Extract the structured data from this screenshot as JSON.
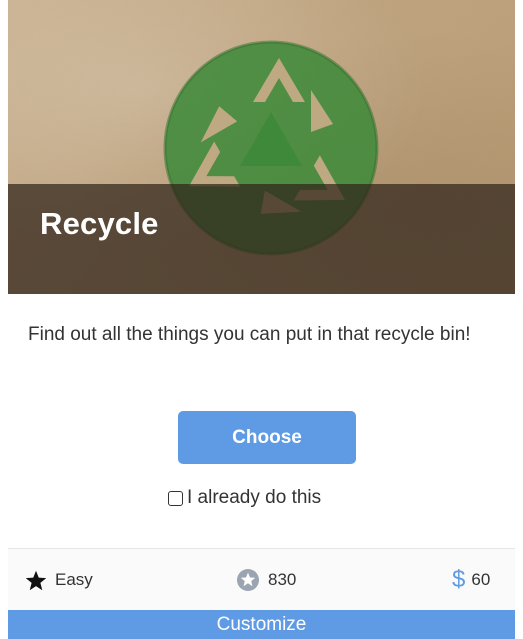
{
  "card": {
    "title": "Recycle",
    "description": "Find out all the things you can put in that recycle bin!",
    "choose_label": "Choose",
    "already_label": "I already do this",
    "already_checked": false,
    "stats": {
      "difficulty": "Easy",
      "points": "830",
      "cost": "60"
    },
    "customize_label": "Customize"
  },
  "icons": {
    "hero": "recycle-symbol",
    "difficulty": "star-icon",
    "points": "points-badge-icon",
    "cost": "dollar-icon"
  },
  "colors": {
    "accent": "#5e9be4",
    "overlay": "#30241a",
    "recycle_green": "#3f8a3a",
    "text": "#333333"
  }
}
